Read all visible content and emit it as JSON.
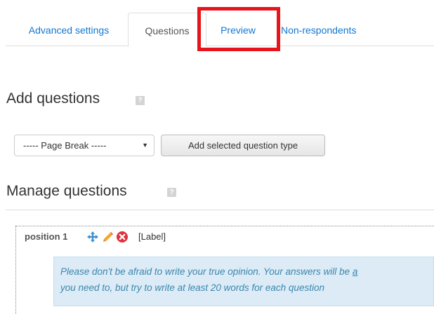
{
  "tabs": [
    {
      "label": "Advanced settings"
    },
    {
      "label": "Questions"
    },
    {
      "label": "Preview"
    },
    {
      "label": "Non-respondents"
    }
  ],
  "add_section": {
    "title": "Add questions",
    "help_icon": "?",
    "select_value": "----- Page Break -----",
    "add_button_label": "Add selected question type"
  },
  "manage_section": {
    "title": "Manage questions",
    "help_icon": "?",
    "question": {
      "position_label": "position 1",
      "type_label": "[Label]",
      "text_line1": "Please don't be afraid to write your true opinion. Your answers will be ",
      "text_line1_link": "a",
      "text_line2": "you need to, but try to write at least 20 words for each question"
    }
  },
  "colors": {
    "link": "#1177d1",
    "highlight": "#e8141c",
    "info_bg": "#dcebf6",
    "info_text": "#3a87ad"
  },
  "icons": [
    "move-icon",
    "edit-icon",
    "delete-icon",
    "help-icon",
    "chevron-down-icon"
  ]
}
